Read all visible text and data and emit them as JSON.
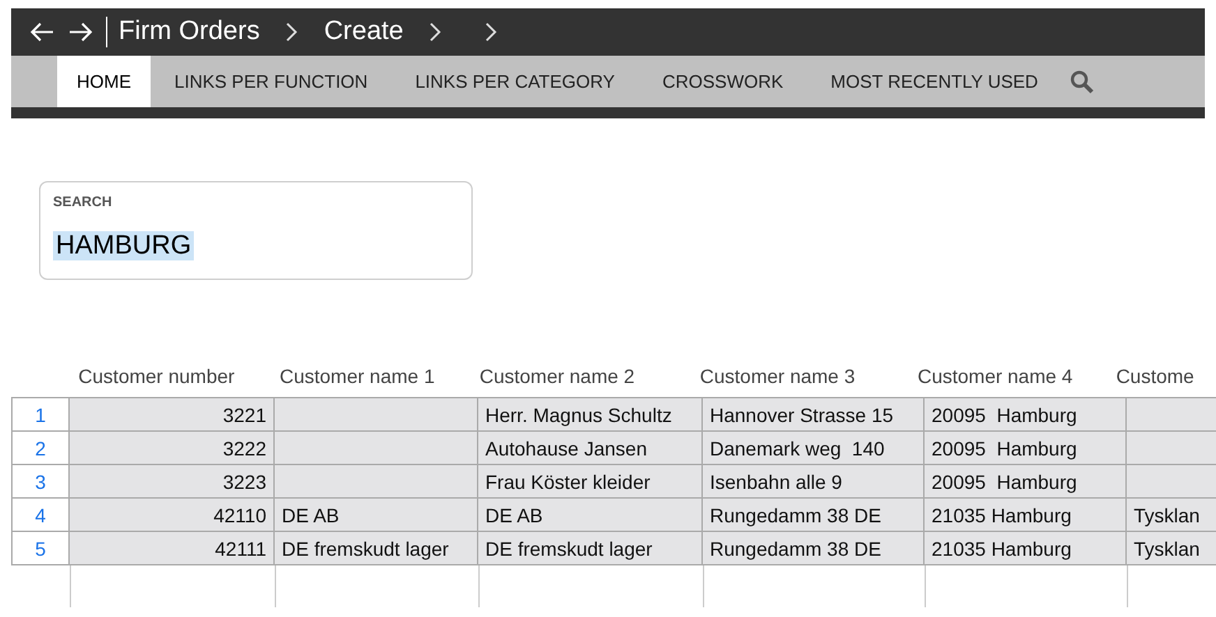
{
  "breadcrumb": {
    "items": [
      "Firm Orders",
      "Create"
    ]
  },
  "tabs": [
    {
      "label": "HOME",
      "selected": true
    },
    {
      "label": "LINKS PER FUNCTION",
      "selected": false
    },
    {
      "label": "LINKS PER CATEGORY",
      "selected": false
    },
    {
      "label": "CROSSWORK",
      "selected": false
    },
    {
      "label": "MOST RECENTLY USED",
      "selected": false
    }
  ],
  "search": {
    "label": "SEARCH",
    "value": "HAMBURG",
    "value_selected": true
  },
  "table": {
    "columns": [
      "Customer number",
      "Customer name 1",
      "Customer name 2",
      "Customer name 3",
      "Customer name 4",
      "Custome"
    ],
    "rows": [
      {
        "index": "1",
        "cells": [
          "3221",
          "",
          "Herr. Magnus Schultz",
          "Hannover Strasse 15",
          "20095  Hamburg",
          ""
        ]
      },
      {
        "index": "2",
        "cells": [
          "3222",
          "",
          "Autohause Jansen",
          "Danemark weg  140",
          "20095  Hamburg",
          ""
        ]
      },
      {
        "index": "3",
        "cells": [
          "3223",
          "",
          "Frau Köster kleider",
          "Isenbahn alle 9",
          "20095  Hamburg",
          ""
        ]
      },
      {
        "index": "4",
        "cells": [
          "42110",
          "DE AB",
          "DE AB",
          "Rungedamm 38 DE",
          "21035 Hamburg",
          "Tysklan"
        ]
      },
      {
        "index": "5",
        "cells": [
          "42111",
          "DE fremskudt lager",
          "DE fremskudt lager",
          "Rungedamm 38 DE",
          "21035 Hamburg",
          "Tysklan"
        ]
      }
    ]
  }
}
